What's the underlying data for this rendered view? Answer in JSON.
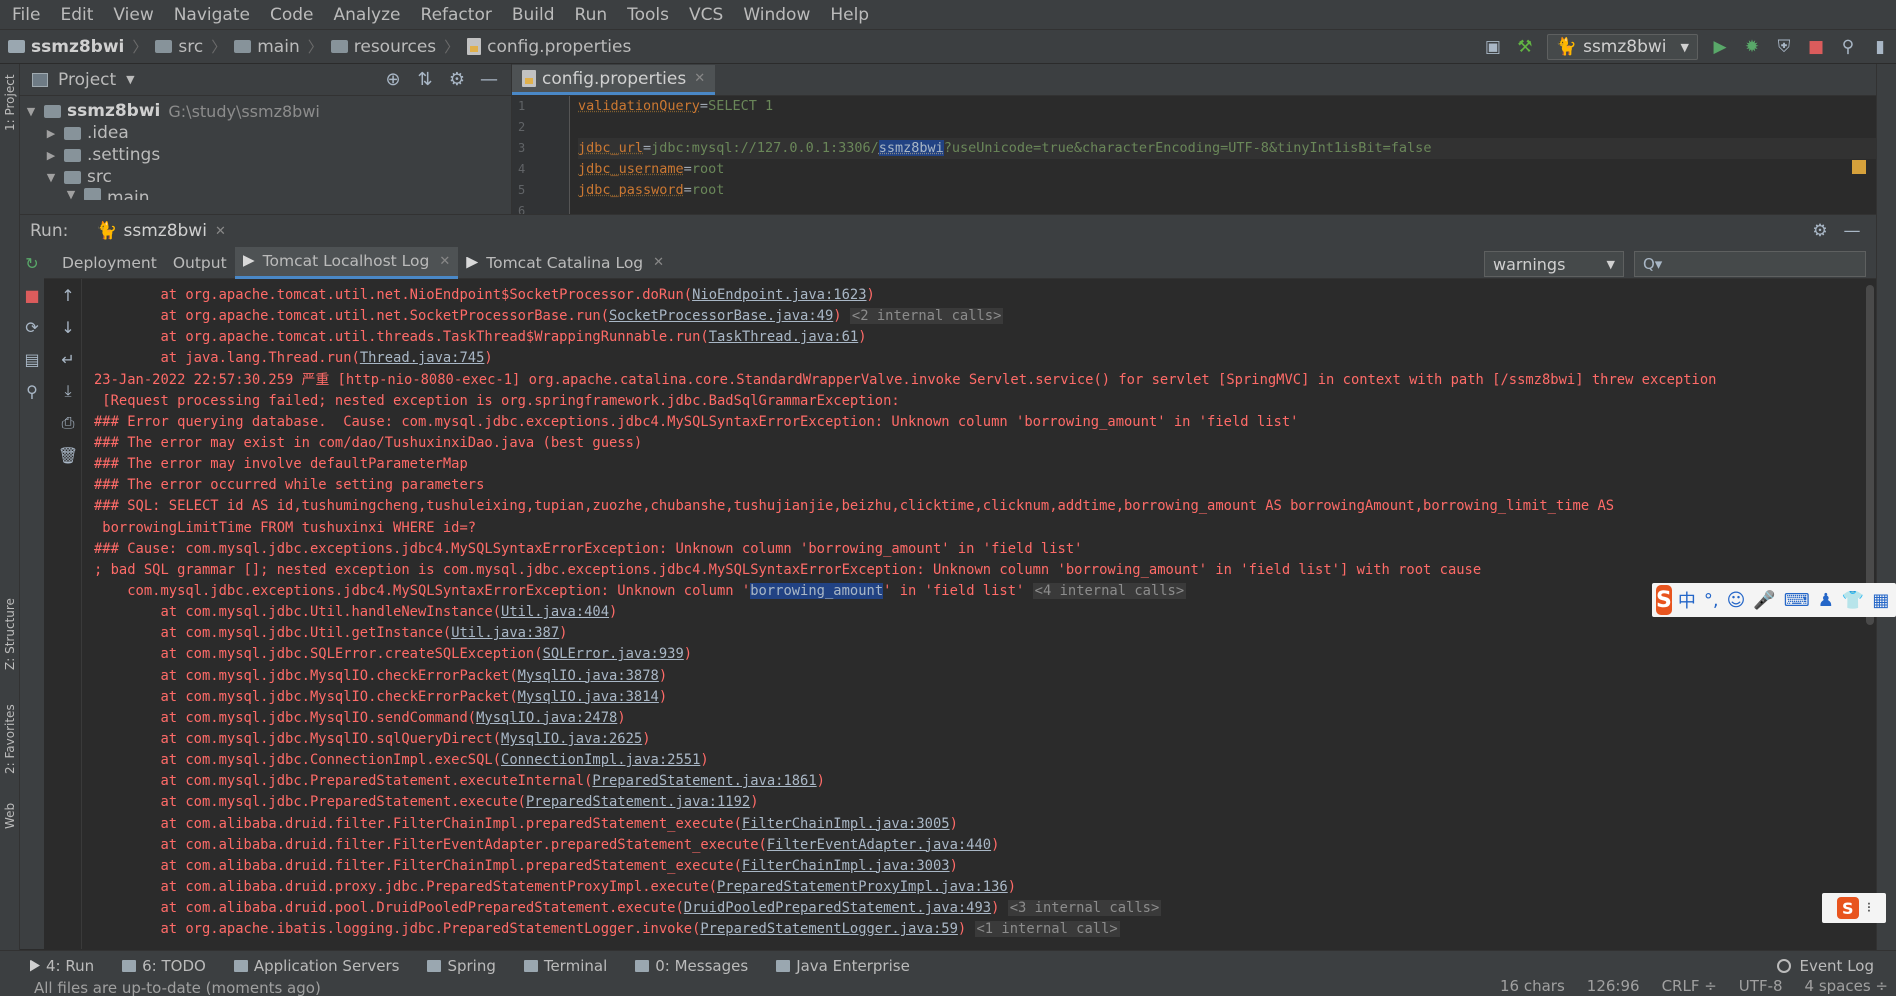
{
  "menu": [
    "File",
    "Edit",
    "View",
    "Navigate",
    "Code",
    "Analyze",
    "Refactor",
    "Build",
    "Run",
    "Tools",
    "VCS",
    "Window",
    "Help"
  ],
  "breadcrumb": {
    "project": "ssmz8bwi",
    "items": [
      "src",
      "main",
      "resources"
    ],
    "file": "config.properties"
  },
  "toolbar": {
    "run_config": "ssmz8bwi"
  },
  "project_panel": {
    "title": "Project",
    "root": "ssmz8bwi",
    "root_path": "G:\\study\\ssmz8bwi",
    "children": [
      ".idea",
      ".settings",
      "src"
    ],
    "partial": "main"
  },
  "editor": {
    "tab": "config.properties",
    "lines": [
      {
        "num": "1",
        "key": "validationQuery",
        "val": "SELECT 1"
      },
      {
        "num": "2",
        "key": "",
        "val": ""
      },
      {
        "num": "3",
        "key": "jdbc_url",
        "val_pre": "jdbc:mysql://127.0.0.1:3306/",
        "val_hl": "ssmz8bwi",
        "val_post": "?useUnicode=true&characterEncoding=UTF-8&tinyInt1isBit=false"
      },
      {
        "num": "4",
        "key": "jdbc_username",
        "val": "root"
      },
      {
        "num": "5",
        "key": "jdbc_password",
        "val": "root"
      },
      {
        "num": "6",
        "key": "",
        "val": ""
      }
    ]
  },
  "run": {
    "label": "Run:",
    "config": "ssmz8bwi",
    "tabs": [
      "Deployment",
      "Output",
      "Tomcat Localhost Log",
      "Tomcat Catalina Log"
    ],
    "filter": "warnings",
    "search_placeholder": "Q▾"
  },
  "log_lines": [
    {
      "t": "        at org.apache.tomcat.util.net.NioEndpoint$SocketProcessor.doRun(",
      "l": "NioEndpoint.java:1623",
      "a": ")"
    },
    {
      "t": "        at org.apache.tomcat.util.net.SocketProcessorBase.run(",
      "l": "SocketProcessorBase.java:49",
      "a": ") ",
      "i": "<2 internal calls>"
    },
    {
      "t": "        at org.apache.tomcat.util.threads.TaskThread$WrappingRunnable.run(",
      "l": "TaskThread.java:61",
      "a": ")"
    },
    {
      "t": "        at java.lang.Thread.run(",
      "l": "Thread.java:745",
      "a": ")"
    },
    {
      "t": "23-Jan-2022 22:57:30.259 严重 [http-nio-8080-exec-1] org.apache.catalina.core.StandardWrapperValve.invoke Servlet.service() for servlet [SpringMVC] in context with path [/ssmz8bwi] threw exception"
    },
    {
      "t": " [Request processing failed; nested exception is org.springframework.jdbc.BadSqlGrammarException:"
    },
    {
      "t": "### Error querying database.  Cause: com.mysql.jdbc.exceptions.jdbc4.MySQLSyntaxErrorException: Unknown column 'borrowing_amount' in 'field list'"
    },
    {
      "t": "### The error may exist in com/dao/TushuxinxiDao.java (best guess)"
    },
    {
      "t": "### The error may involve defaultParameterMap"
    },
    {
      "t": "### The error occurred while setting parameters"
    },
    {
      "t": "### SQL: SELECT id AS id,tushumingcheng,tushuleixing,tupian,zuozhe,chubanshe,tushujianjie,beizhu,clicktime,clicknum,addtime,borrowing_amount AS borrowingAmount,borrowing_limit_time AS"
    },
    {
      "t": " borrowingLimitTime FROM tushuxinxi WHERE id=?"
    },
    {
      "t": "### Cause: com.mysql.jdbc.exceptions.jdbc4.MySQLSyntaxErrorException: Unknown column 'borrowing_amount' in 'field list'"
    },
    {
      "t": "; bad SQL grammar []; nested exception is com.mysql.jdbc.exceptions.jdbc4.MySQLSyntaxErrorException: Unknown column 'borrowing_amount' in 'field list'] with root cause"
    },
    {
      "t": "    com.mysql.jdbc.exceptions.jdbc4.MySQLSyntaxErrorException: Unknown column '",
      "s": "borrowing_amount",
      "a": "' in 'field list' ",
      "i": "<4 internal calls>"
    },
    {
      "t": "        at com.mysql.jdbc.Util.handleNewInstance(",
      "l": "Util.java:404",
      "a": ")"
    },
    {
      "t": "        at com.mysql.jdbc.Util.getInstance(",
      "l": "Util.java:387",
      "a": ")"
    },
    {
      "t": "        at com.mysql.jdbc.SQLError.createSQLException(",
      "l": "SQLError.java:939",
      "a": ")"
    },
    {
      "t": "        at com.mysql.jdbc.MysqlIO.checkErrorPacket(",
      "l": "MysqlIO.java:3878",
      "a": ")"
    },
    {
      "t": "        at com.mysql.jdbc.MysqlIO.checkErrorPacket(",
      "l": "MysqlIO.java:3814",
      "a": ")"
    },
    {
      "t": "        at com.mysql.jdbc.MysqlIO.sendCommand(",
      "l": "MysqlIO.java:2478",
      "a": ")"
    },
    {
      "t": "        at com.mysql.jdbc.MysqlIO.sqlQueryDirect(",
      "l": "MysqlIO.java:2625",
      "a": ")"
    },
    {
      "t": "        at com.mysql.jdbc.ConnectionImpl.execSQL(",
      "l": "ConnectionImpl.java:2551",
      "a": ")"
    },
    {
      "t": "        at com.mysql.jdbc.PreparedStatement.executeInternal(",
      "l": "PreparedStatement.java:1861",
      "a": ")"
    },
    {
      "t": "        at com.mysql.jdbc.PreparedStatement.execute(",
      "l": "PreparedStatement.java:1192",
      "a": ")"
    },
    {
      "t": "        at com.alibaba.druid.filter.FilterChainImpl.preparedStatement_execute(",
      "l": "FilterChainImpl.java:3005",
      "a": ")"
    },
    {
      "t": "        at com.alibaba.druid.filter.FilterEventAdapter.preparedStatement_execute(",
      "l": "FilterEventAdapter.java:440",
      "a": ")"
    },
    {
      "t": "        at com.alibaba.druid.filter.FilterChainImpl.preparedStatement_execute(",
      "l": "FilterChainImpl.java:3003",
      "a": ")"
    },
    {
      "t": "        at com.alibaba.druid.proxy.jdbc.PreparedStatementProxyImpl.execute(",
      "l": "PreparedStatementProxyImpl.java:136",
      "a": ")"
    },
    {
      "t": "        at com.alibaba.druid.pool.DruidPooledPreparedStatement.execute(",
      "l": "DruidPooledPreparedStatement.java:493",
      "a": ") ",
      "i": "<3 internal calls>"
    },
    {
      "t": "        at org.apache.ibatis.logging.jdbc.PreparedStatementLogger.invoke(",
      "l": "PreparedStatementLogger.java:59",
      "a": ") ",
      "i": "<1 internal call>"
    }
  ],
  "ime": {
    "logo": "S",
    "items": [
      "中",
      "°,",
      "☺",
      "🎤",
      "⌨",
      "♟",
      "👕",
      "▦"
    ]
  },
  "bottom_tools": [
    {
      "label": "4: Run",
      "active": true
    },
    {
      "label": "6: TODO"
    },
    {
      "label": "Application Servers"
    },
    {
      "label": "Spring"
    },
    {
      "label": "Terminal"
    },
    {
      "label": "0: Messages"
    },
    {
      "label": "Java Enterprise"
    }
  ],
  "event_log": "Event Log",
  "status": {
    "message": "All files are up-to-date (moments ago)",
    "chars": "16 chars",
    "position": "126:96",
    "line_sep": "CRLF ÷",
    "encoding": "UTF-8",
    "indent": "4 spaces ÷"
  },
  "side_tabs": {
    "project": "1: Project",
    "structure": "Z: Structure",
    "favorites": "2: Favorites",
    "web": "Web"
  }
}
